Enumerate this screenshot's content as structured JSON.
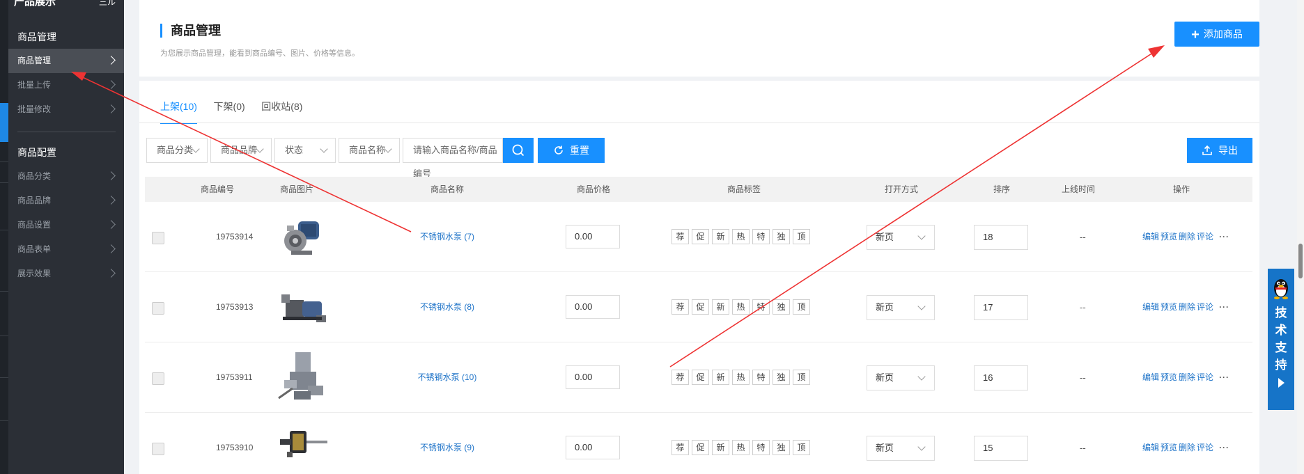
{
  "sidebar": {
    "title": "产品展示",
    "menu_icon": "三ル",
    "groups": [
      {
        "label": "商品管理",
        "items": [
          {
            "label": "商品管理",
            "active": true
          },
          {
            "label": "批量上传",
            "active": false
          },
          {
            "label": "批量修改",
            "active": false
          }
        ]
      },
      {
        "label": "商品配置",
        "items": [
          {
            "label": "商品分类",
            "active": false
          },
          {
            "label": "商品品牌",
            "active": false
          },
          {
            "label": "商品设置",
            "active": false
          },
          {
            "label": "商品表单",
            "active": false
          },
          {
            "label": "展示效果",
            "active": false
          }
        ]
      }
    ]
  },
  "header": {
    "title": "商品管理",
    "description": "为您展示商品管理，能看到商品编号、图片、价格等信息。",
    "add_button": "添加商品"
  },
  "tabs": [
    {
      "label": "上架(10)",
      "active": true
    },
    {
      "label": "下架(0)",
      "active": false
    },
    {
      "label": "回收站(8)",
      "active": false
    }
  ],
  "filters": {
    "category": "商品分类",
    "brand": "商品品牌",
    "status": "状态",
    "field": "商品名称",
    "search_placeholder": "请输入商品名称/商品编号",
    "reset": "重置",
    "export": "导出"
  },
  "table": {
    "columns": [
      "商品编号",
      "商品图片",
      "商品名称",
      "商品价格",
      "商品标签",
      "打开方式",
      "排序",
      "上线时间",
      "操作"
    ],
    "tags": [
      "荐",
      "促",
      "新",
      "热",
      "特",
      "独",
      "顶"
    ],
    "ops": [
      "编辑",
      "预览",
      "删除",
      "评论"
    ],
    "more": "···",
    "rows": [
      {
        "code": "19753914",
        "name": "不锈钢水泵 (7)",
        "price": "0.00",
        "open": "新页",
        "sort": "18",
        "online": "--",
        "image": "pump-motor"
      },
      {
        "code": "19753913",
        "name": "不锈钢水泵 (8)",
        "price": "0.00",
        "open": "新页",
        "sort": "17",
        "online": "--",
        "image": "pump-horizontal"
      },
      {
        "code": "19753911",
        "name": "不锈钢水泵 (10)",
        "price": "0.00",
        "open": "新页",
        "sort": "16",
        "online": "--",
        "image": "pump-vertical"
      },
      {
        "code": "19753910",
        "name": "不锈钢水泵 (9)",
        "price": "0.00",
        "open": "新页",
        "sort": "15",
        "online": "--",
        "image": "pump-shaft"
      }
    ]
  },
  "support": {
    "text": [
      "技",
      "术",
      "支",
      "持"
    ]
  },
  "colors": {
    "primary": "#1890ff",
    "sidebar": "#2b2f36",
    "annotation_arrow": "#ee3333"
  }
}
